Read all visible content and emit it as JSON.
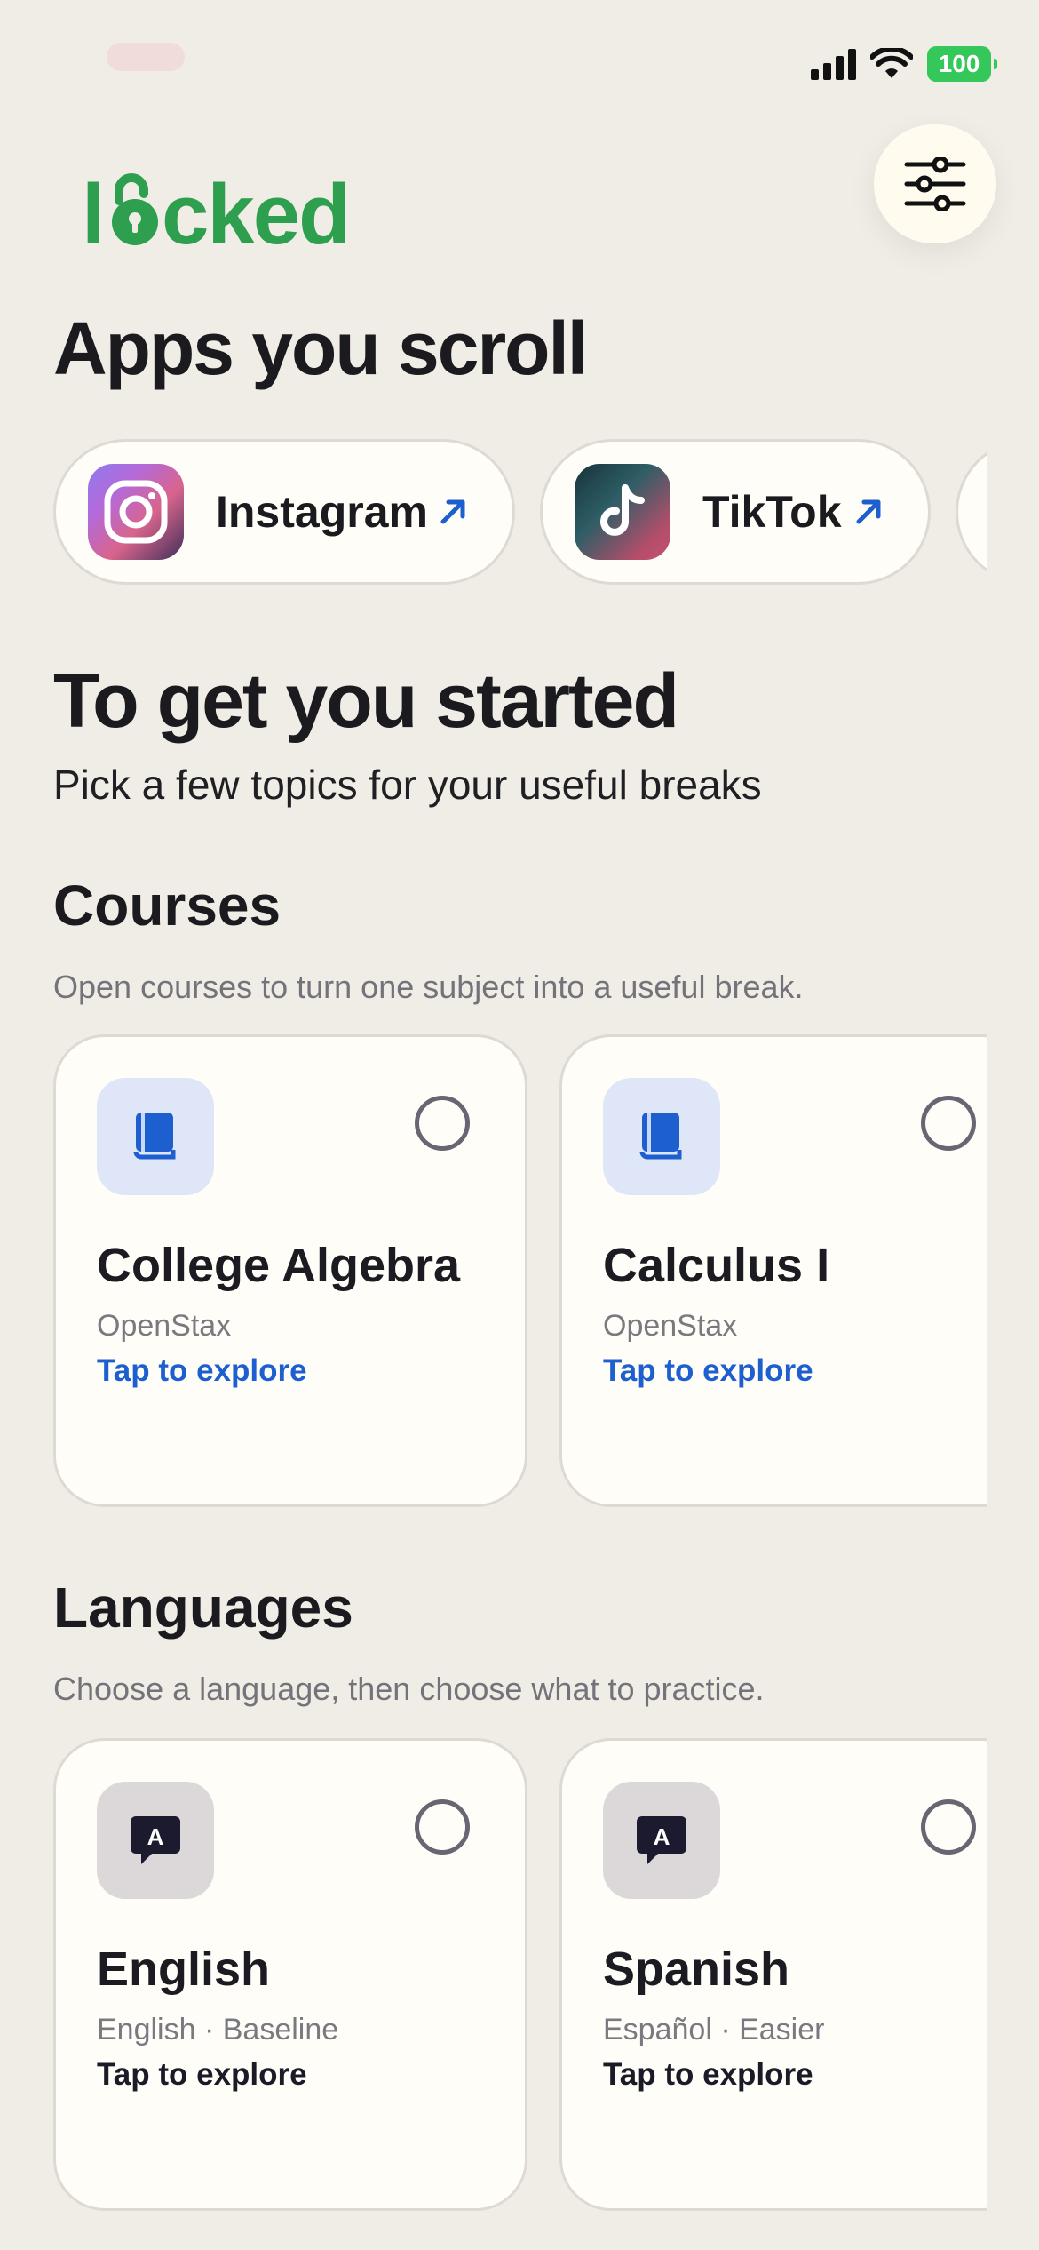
{
  "status_bar": {
    "battery": "100"
  },
  "header": {
    "logo_text": "Locked"
  },
  "apps_section": {
    "title": "Apps you scroll",
    "apps": [
      {
        "name": "Instagram",
        "icon": "instagram-icon"
      },
      {
        "name": "TikTok",
        "icon": "tiktok-icon"
      }
    ]
  },
  "intro": {
    "title": "To get you started",
    "subtitle": "Pick a few topics for your useful breaks"
  },
  "courses": {
    "title": "Courses",
    "description": "Open courses to turn one subject into a useful break.",
    "items": [
      {
        "title": "College Algebra",
        "provider": "OpenStax",
        "action": "Tap to explore",
        "icon": "book-icon",
        "selected": false
      },
      {
        "title": "Calculus I",
        "provider": "OpenStax",
        "action": "Tap to explore",
        "icon": "book-icon",
        "selected": false
      }
    ]
  },
  "languages": {
    "title": "Languages",
    "description": "Choose a language, then choose what to practice.",
    "items": [
      {
        "title": "English",
        "detail": "English · Baseline",
        "action": "Tap to explore",
        "icon": "translate-bubble-icon",
        "selected": false
      },
      {
        "title": "Spanish",
        "detail": "Español · Easier",
        "action": "Tap to explore",
        "icon": "translate-bubble-icon",
        "selected": false
      }
    ]
  },
  "colors": {
    "background": "#f0ede6",
    "card": "#fffdf8",
    "brand_green": "#2e9e4f",
    "link_blue": "#1d5fcf",
    "battery_green": "#34c759"
  }
}
